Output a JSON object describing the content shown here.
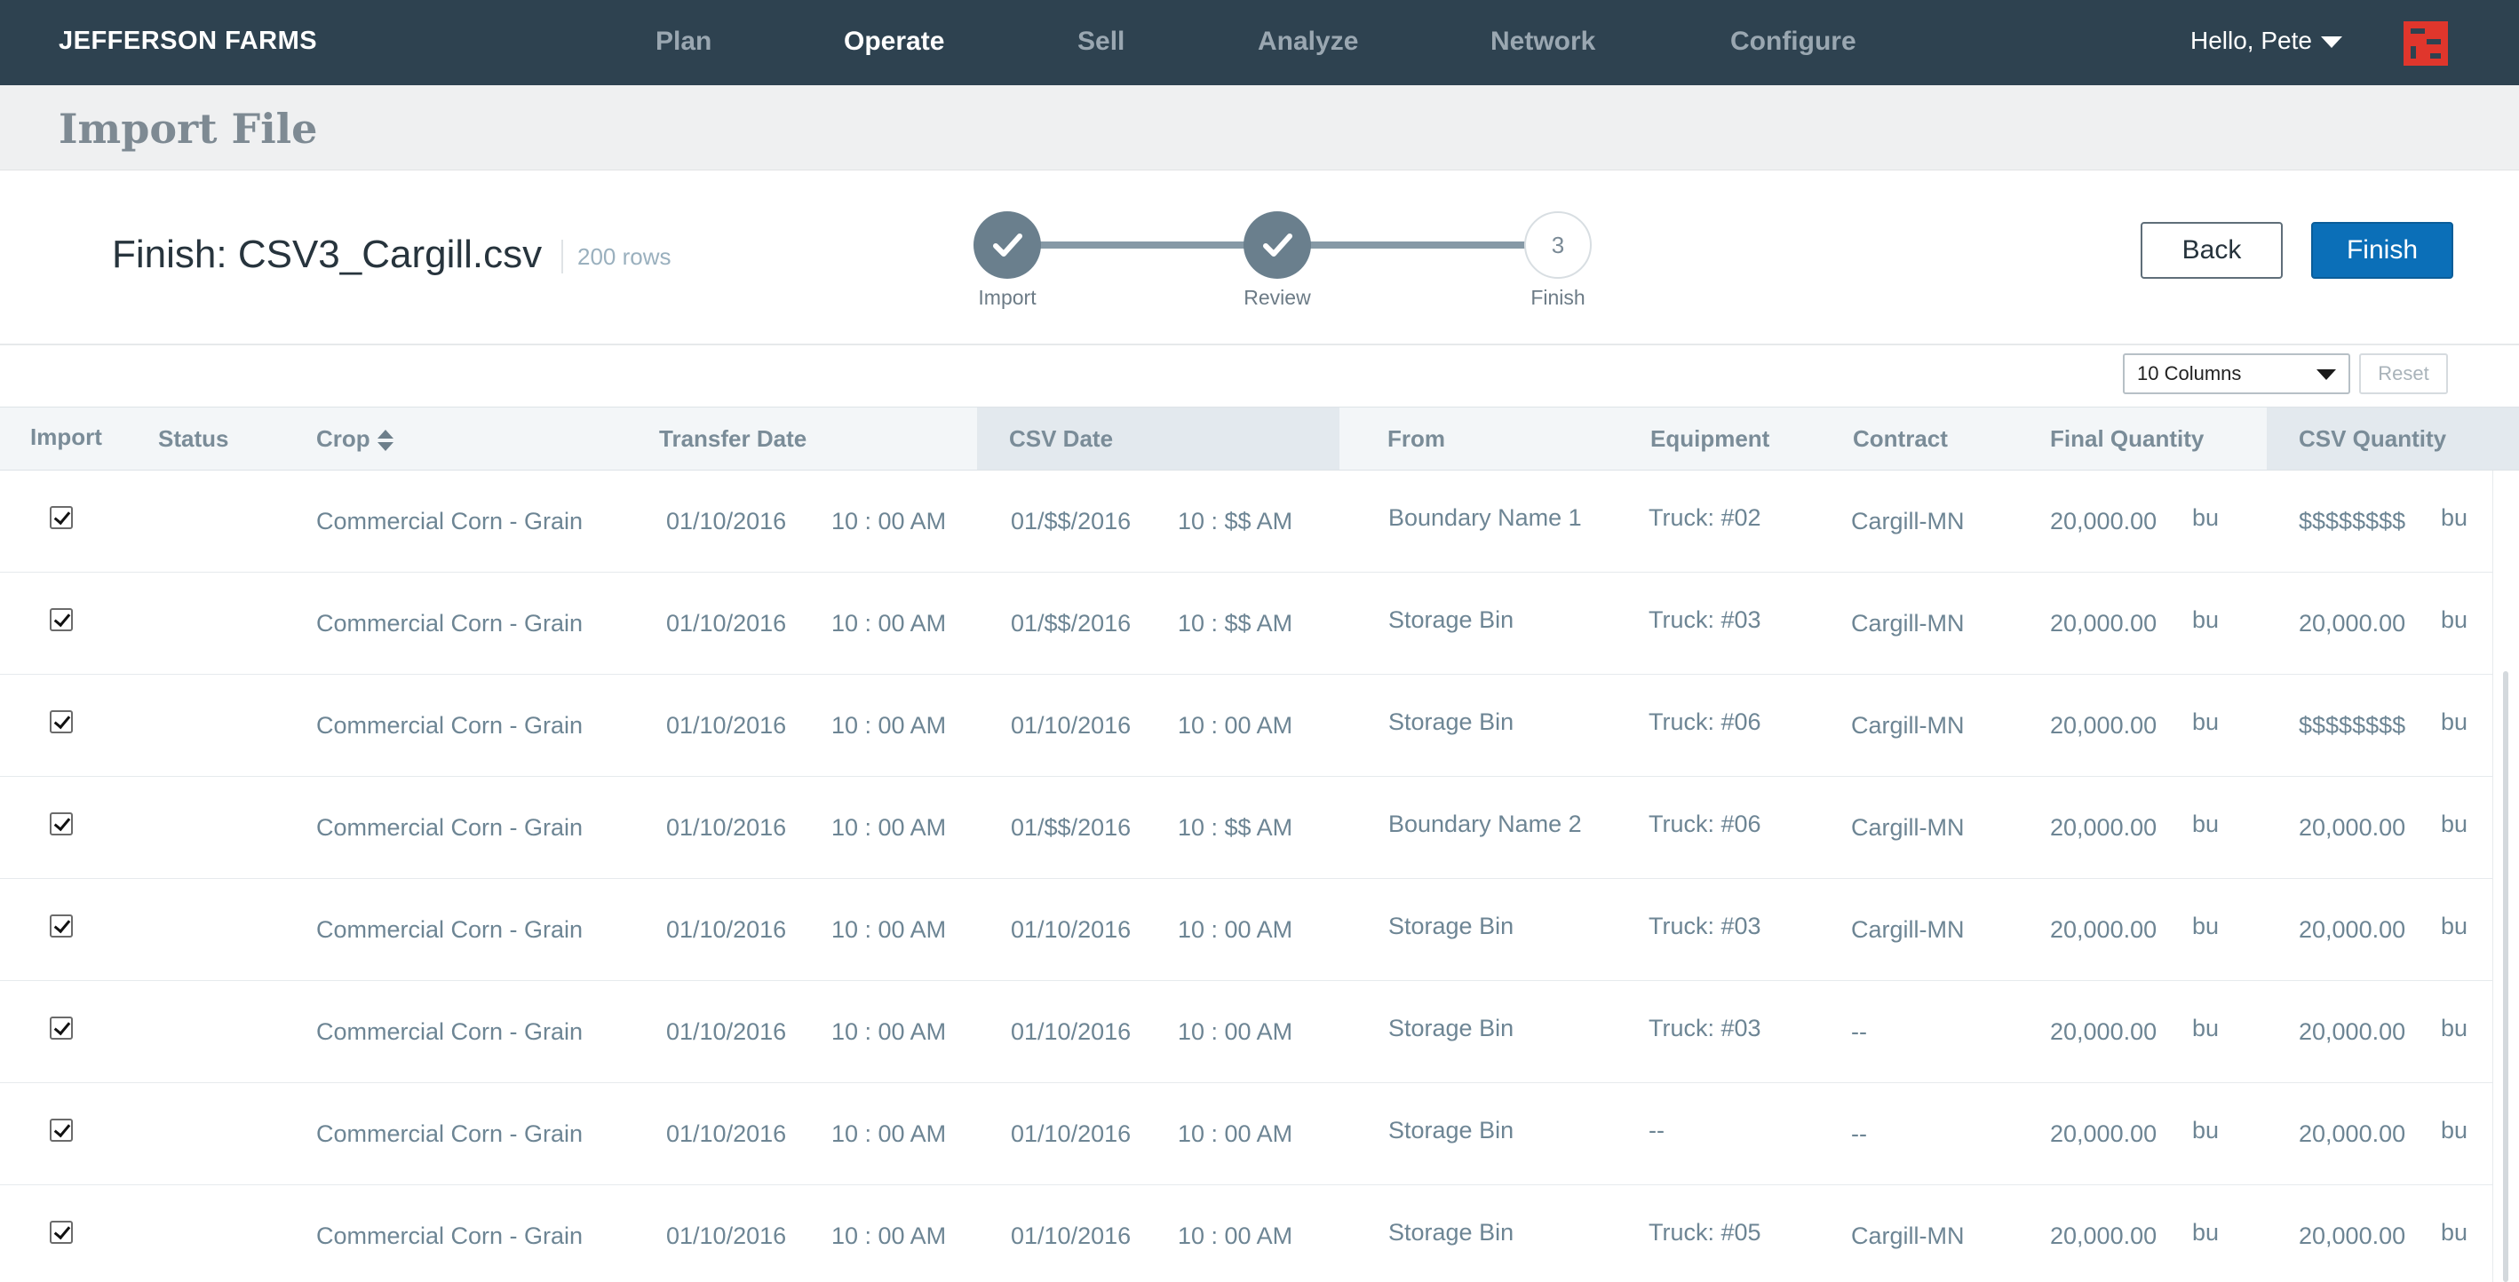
{
  "app": {
    "brand": "JEFFERSON FARMS",
    "nav": [
      "Plan",
      "Operate",
      "Sell",
      "Analyze",
      "Network",
      "Configure"
    ],
    "active_nav": "Operate",
    "user_greeting": "Hello, Pete",
    "logo_icon": "farm-logo-icon",
    "brand_color": "#2e4250",
    "logo_color": "#e0362c"
  },
  "page": {
    "title": "Import File"
  },
  "wizard": {
    "title": "Finish: CSV3_Cargill.csv",
    "rows_count": "200 rows",
    "steps": [
      {
        "label": "Import",
        "state": "done",
        "icon": "checkmark-icon"
      },
      {
        "label": "Review",
        "state": "done",
        "icon": "checkmark-icon"
      },
      {
        "label": "Finish",
        "state": "current",
        "number": "3"
      }
    ],
    "back_label": "Back",
    "finish_label": "Finish",
    "accent_color": "#0b6fb8"
  },
  "table_controls": {
    "columns_select": "10 Columns",
    "reset_label": "Reset"
  },
  "table": {
    "headers": {
      "import": "Import",
      "status": "Status",
      "crop": "Crop",
      "transfer_date": "Transfer Date",
      "csv_date": "CSV Date",
      "from": "From",
      "equipment": "Equipment",
      "contract": "Contract",
      "final_quantity": "Final Quantity",
      "csv_quantity": "CSV Quantity"
    },
    "rows": [
      {
        "checked": true,
        "crop": "Commercial Corn - Grain",
        "t_date": "01/10/2016",
        "t_time": "10 : 00 AM",
        "c_date": "01/$$/2016",
        "c_time": "10 : $$  AM",
        "from": "Boundary Name 1",
        "equipment": "Truck: #02",
        "contract": "Cargill-MN",
        "final_qty": "20,000.00",
        "final_unit": "bu",
        "csv_qty": "$$$$$$$$",
        "csv_unit": "bu"
      },
      {
        "checked": true,
        "crop": "Commercial Corn - Grain",
        "t_date": "01/10/2016",
        "t_time": "10 : 00 AM",
        "c_date": "01/$$/2016",
        "c_time": "10 : $$  AM",
        "from": "Storage Bin",
        "equipment": "Truck: #03",
        "contract": "Cargill-MN",
        "final_qty": "20,000.00",
        "final_unit": "bu",
        "csv_qty": "20,000.00",
        "csv_unit": "bu"
      },
      {
        "checked": true,
        "crop": "Commercial Corn - Grain",
        "t_date": "01/10/2016",
        "t_time": "10 : 00 AM",
        "c_date": "01/10/2016",
        "c_time": "10 : 00 AM",
        "from": "Storage Bin",
        "equipment": "Truck: #06",
        "contract": "Cargill-MN",
        "final_qty": "20,000.00",
        "final_unit": "bu",
        "csv_qty": "$$$$$$$$",
        "csv_unit": "bu"
      },
      {
        "checked": true,
        "crop": "Commercial Corn - Grain",
        "t_date": "01/10/2016",
        "t_time": "10 : 00 AM",
        "c_date": "01/$$/2016",
        "c_time": "10 : $$  AM",
        "from": "Boundary Name 2",
        "equipment": "Truck: #06",
        "contract": "Cargill-MN",
        "final_qty": "20,000.00",
        "final_unit": "bu",
        "csv_qty": "20,000.00",
        "csv_unit": "bu"
      },
      {
        "checked": true,
        "crop": "Commercial Corn - Grain",
        "t_date": "01/10/2016",
        "t_time": "10 : 00 AM",
        "c_date": "01/10/2016",
        "c_time": "10 : 00 AM",
        "from": "Storage Bin",
        "equipment": "Truck: #03",
        "contract": "Cargill-MN",
        "final_qty": "20,000.00",
        "final_unit": "bu",
        "csv_qty": "20,000.00",
        "csv_unit": "bu"
      },
      {
        "checked": true,
        "crop": "Commercial Corn - Grain",
        "t_date": "01/10/2016",
        "t_time": "10 : 00 AM",
        "c_date": "01/10/2016",
        "c_time": "10 : 00 AM",
        "from": "Storage Bin",
        "equipment": "Truck: #03",
        "contract": "--",
        "final_qty": "20,000.00",
        "final_unit": "bu",
        "csv_qty": "20,000.00",
        "csv_unit": "bu"
      },
      {
        "checked": true,
        "crop": "Commercial Corn - Grain",
        "t_date": "01/10/2016",
        "t_time": "10 : 00 AM",
        "c_date": "01/10/2016",
        "c_time": "10 : 00 AM",
        "from": "Storage Bin",
        "equipment": "--",
        "contract": "--",
        "final_qty": "20,000.00",
        "final_unit": "bu",
        "csv_qty": "20,000.00",
        "csv_unit": "bu"
      },
      {
        "checked": true,
        "crop": "Commercial Corn - Grain",
        "t_date": "01/10/2016",
        "t_time": "10 : 00 AM",
        "c_date": "01/10/2016",
        "c_time": "10 : 00 AM",
        "from": "Storage Bin",
        "equipment": "Truck: #05",
        "contract": "Cargill-MN",
        "final_qty": "20,000.00",
        "final_unit": "bu",
        "csv_qty": "20,000.00",
        "csv_unit": "bu"
      }
    ]
  }
}
